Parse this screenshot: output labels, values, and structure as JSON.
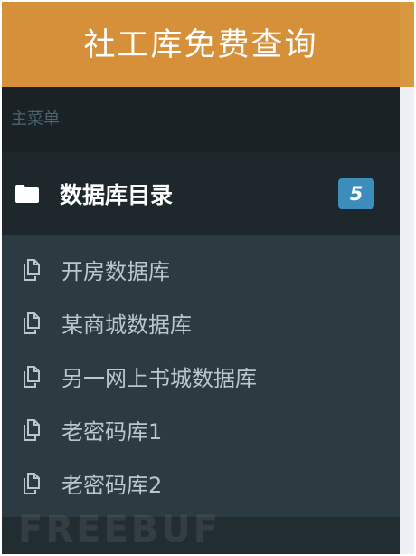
{
  "header": {
    "title": "社工库免费查询"
  },
  "sidebar": {
    "menu_header": "主菜单",
    "tree": {
      "icon": "folder-icon",
      "label": "数据库目录",
      "badge": "5",
      "badge_color": "#3c8dbc"
    },
    "submenu": [
      {
        "label": "开房数据库",
        "icon": "copy-icon"
      },
      {
        "label": "某商城数据库",
        "icon": "copy-icon"
      },
      {
        "label": "另一网上书城数据库",
        "icon": "copy-icon"
      },
      {
        "label": "老密码库1",
        "icon": "copy-icon"
      },
      {
        "label": "老密码库2",
        "icon": "copy-icon"
      }
    ]
  },
  "watermark": "FREEBUF",
  "colors": {
    "header": "#d6903a",
    "sidebar": "#222d32",
    "submenu": "#2c3b41"
  }
}
